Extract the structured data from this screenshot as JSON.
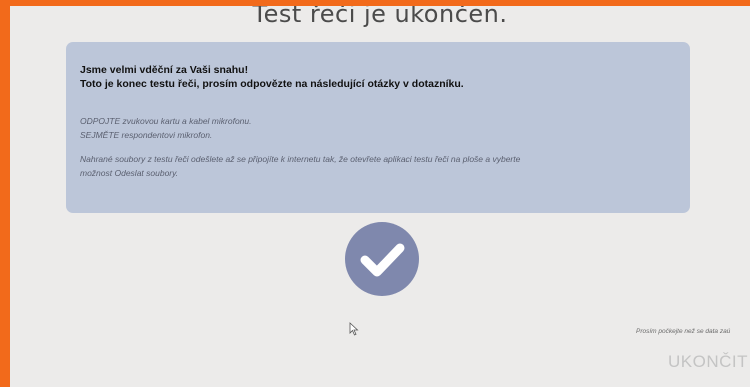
{
  "title": "Test řeči je ukončen.",
  "message": {
    "thanks": "Jsme velmi vděční za Vaši snahu!",
    "end_line": "Toto je konec testu řeči, prosím odpovězte na následující otázky v dotazníku.",
    "instruction_1": "ODPOJTE zvukovou kartu a kabel mikrofonu.",
    "instruction_2": "SEJMĚTE respondentovi mikrofon.",
    "upload_line_1": "Nahrané soubory z testu řeči odešlete až se připojíte k internetu tak, že otevřete aplikaci testu řeči na ploše a vyberte",
    "upload_line_2": "možnost Odeslat soubory."
  },
  "wait_note": "Prosím počkejte než se data zaú",
  "end_button_label": "UKONČIT",
  "icons": {
    "status": "check-circle-icon",
    "pointer": "mouse-cursor-icon"
  },
  "colors": {
    "frame": "#f26a1b",
    "panel": "#bcc6d9",
    "check": "#7f88ad"
  }
}
